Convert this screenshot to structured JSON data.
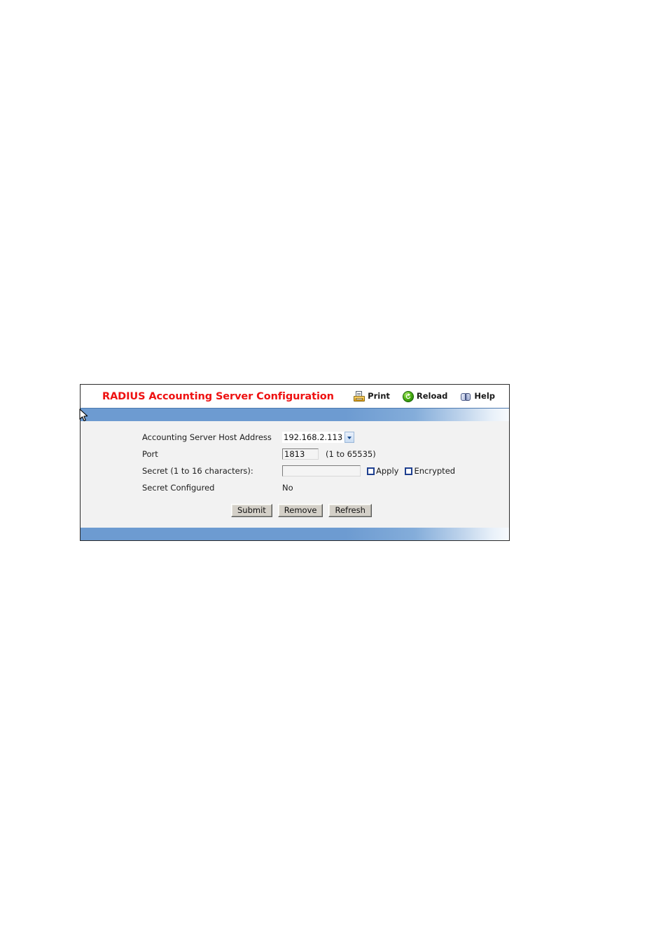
{
  "panel": {
    "title": "RADIUS Accounting Server Configuration",
    "title_color": "#ee1111",
    "accent_color": "#6d9bd1",
    "background_color": "#f2f2f2"
  },
  "toolbar": {
    "items": [
      {
        "label": "Print",
        "icon": "printer-icon"
      },
      {
        "label": "Reload",
        "icon": "reload-icon"
      },
      {
        "label": "Help",
        "icon": "help-book-icon"
      }
    ]
  },
  "form": {
    "host": {
      "label": "Accounting Server Host Address",
      "value": "192.168.2.113",
      "options": [
        "192.168.2.113"
      ],
      "icon": "chevron-down-icon"
    },
    "port": {
      "label": "Port",
      "value": "1813",
      "hint": "(1 to 65535)"
    },
    "secret": {
      "label": "Secret (1 to 16 characters):",
      "value": "",
      "placeholder": "",
      "apply_label": "Apply",
      "apply_checked": false,
      "encrypted_label": "Encrypted",
      "encrypted_checked": false
    },
    "secret_configured": {
      "label": "Secret Configured",
      "value": "No"
    }
  },
  "buttons": {
    "submit": "Submit",
    "remove": "Remove",
    "refresh": "Refresh"
  }
}
